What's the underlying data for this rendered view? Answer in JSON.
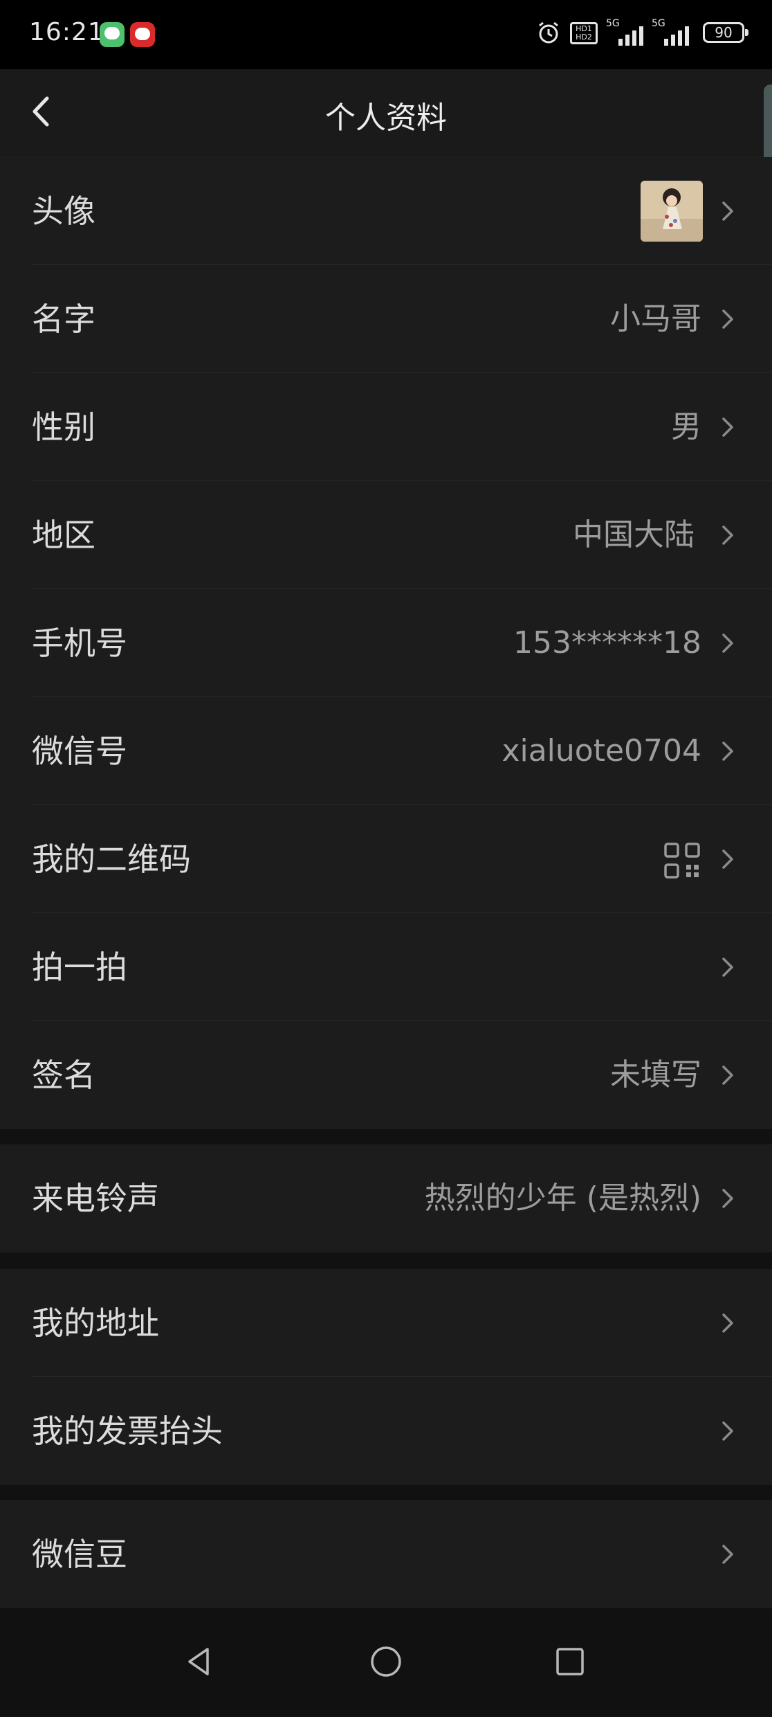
{
  "status_bar": {
    "time": "16:21",
    "battery": "90",
    "network": "5G",
    "hd": "HD1 HD2"
  },
  "header": {
    "title": "个人资料"
  },
  "icons": {
    "back": "chevron-left-icon",
    "row_arrow": "chevron-right-icon",
    "qr": "qr-code-icon"
  },
  "colors": {
    "background": "#111111",
    "row_background": "#1c1c1c",
    "label_text": "#dcdcdc",
    "value_text": "#9d9d9d"
  },
  "profile": {
    "avatar_label": "头像",
    "name_label": "名字",
    "name_value": "小马哥",
    "gender_label": "性别",
    "gender_value": "男",
    "region_label": "地区",
    "region_value": "中国大陆",
    "phone_label": "手机号",
    "phone_value": "153******18",
    "wechat_id_label": "微信号",
    "wechat_id_value": "xialuote0704",
    "qrcode_label": "我的二维码",
    "pat_label": "拍一拍",
    "signature_label": "签名",
    "signature_value": "未填写"
  },
  "ringtone": {
    "label": "来电铃声",
    "value": "热烈的少年 (是热烈)"
  },
  "address": {
    "my_address_label": "我的地址",
    "invoice_label": "我的发票抬头"
  },
  "beans": {
    "label": "微信豆"
  },
  "nav": {
    "back": "back-triangle-icon",
    "home": "home-circle-icon",
    "recents": "recents-square-icon"
  }
}
